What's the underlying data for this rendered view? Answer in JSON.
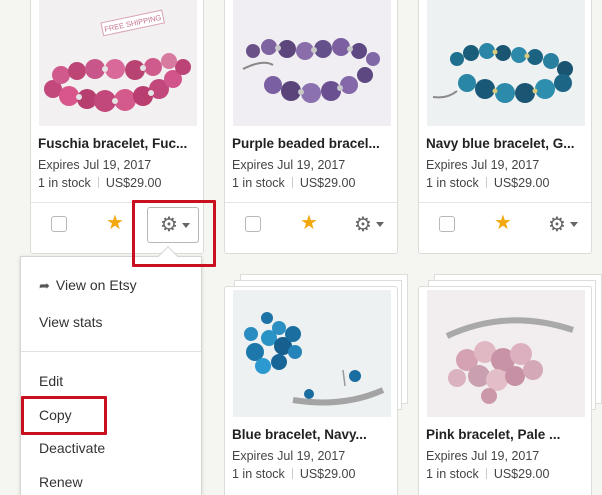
{
  "cards": [
    {
      "title": "Fuschia bracelet, Fuc...",
      "expires": "Expires Jul 19, 2017",
      "stock": "1 in stock",
      "price": "US$29.00",
      "badge": "FREE SHIPPING"
    },
    {
      "title": "Purple beaded bracel...",
      "expires": "Expires Jul 19, 2017",
      "stock": "1 in stock",
      "price": "US$29.00"
    },
    {
      "title": "Navy blue bracelet, G...",
      "expires": "Expires Jul 19, 2017",
      "stock": "1 in stock",
      "price": "US$29.00"
    },
    {
      "title": "Blue bracelet, Navy...",
      "expires": "Expires Jul 19, 2017",
      "stock": "1 in stock",
      "price": "US$29.00"
    },
    {
      "title": "Pink bracelet, Pale ...",
      "expires": "Expires Jul 19, 2017",
      "stock": "1 in stock",
      "price": "US$29.00"
    }
  ],
  "menu": {
    "view_on_etsy": "View on Etsy",
    "view_stats": "View stats",
    "edit": "Edit",
    "copy": "Copy",
    "deactivate": "Deactivate",
    "renew": "Renew"
  },
  "icons": {
    "star": "★",
    "gear": "⚙",
    "external": "➦"
  },
  "colors": {
    "highlight": "#c8101e",
    "star": "#f1a80c"
  }
}
